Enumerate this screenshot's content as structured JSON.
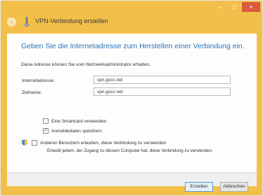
{
  "window": {
    "title": "VPN-Verbindung erstellen",
    "controls": {
      "minimize": "–",
      "maximize": "□",
      "close": "×"
    },
    "back": "‹"
  },
  "main": {
    "heading": "Geben Sie die Internetadresse zum Herstellen einer Verbindung ein.",
    "info": "Diese Adresse können Sie vom Netzwerkadministrator erhalten.",
    "fields": [
      {
        "label": "Internetadresse:",
        "value": "vpn.gvcc.net"
      },
      {
        "label": "Zielname:",
        "value": "vpn.gvcc.net"
      }
    ],
    "options": [
      {
        "label": "Eine Smartcard verwenden",
        "checked": false
      },
      {
        "label": "Anmeldedaten speichern",
        "checked": true
      },
      {
        "label": "Anderen Benutzern erlauben, diese Verbindung zu verwenden",
        "checked": false
      }
    ],
    "option3_sub": "Erlaubt jedem, der Zugang zu diesem Computer hat, diese Verbindung zu verwenden."
  },
  "footer": {
    "create": "Erstellen",
    "cancel": "Abbrechen"
  },
  "colors": {
    "accent": "#f2c04a",
    "heading": "#2a73b6",
    "close": "#d95a3c"
  },
  "icons": [
    "back-arrow-icon",
    "vpn-icon",
    "shield-icon"
  ]
}
